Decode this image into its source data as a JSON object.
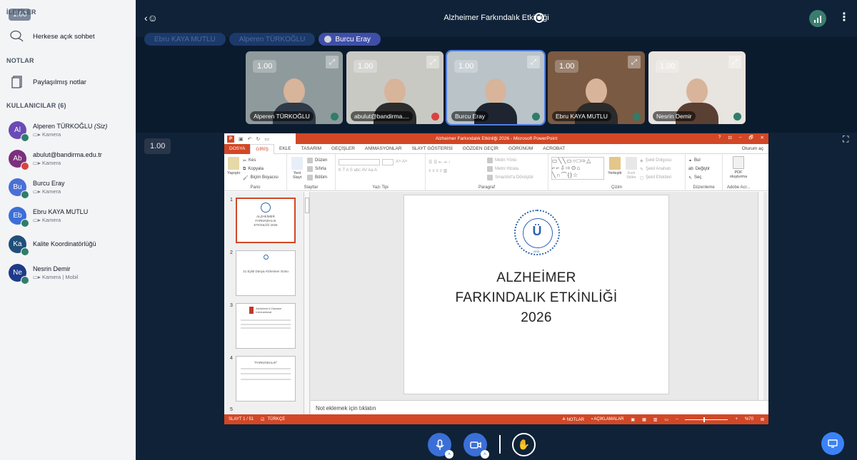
{
  "sidebar": {
    "volume_badge": "1.00",
    "messages_header": "İLETİLER",
    "public_chat": "Herkese açık sohbet",
    "notes_header": "NOTLAR",
    "shared_notes": "Paylaşılmış notlar",
    "users_header": "KULLANICILAR (6)",
    "users": [
      {
        "initials": "Al",
        "name": "Alperen TÜRKOĞLU",
        "suffix": " (Siz)",
        "sub": "Kamera",
        "color": "#6a4bb5",
        "mic": "green"
      },
      {
        "initials": "Ab",
        "name": "abulut@bandirma.edu.tr",
        "suffix": "",
        "sub": "Kamera",
        "color": "#7b2f7c",
        "mic": "red"
      },
      {
        "initials": "Bu",
        "name": "Burcu Eray",
        "suffix": "",
        "sub": "Kamera",
        "color": "#4a6fd6",
        "mic": "green"
      },
      {
        "initials": "Eb",
        "name": "Ebru KAYA MUTLU",
        "suffix": "",
        "sub": "Kamera",
        "color": "#3d6fd6",
        "mic": "green"
      },
      {
        "initials": "Ka",
        "name": "Kalite Koordinatörlüğü",
        "suffix": "",
        "sub": "",
        "color": "#1f4f7a",
        "mic": "green"
      },
      {
        "initials": "Ne",
        "name": "Nesrin Demir",
        "suffix": "",
        "sub": "Kamera | Mobil",
        "color": "#1e3a8a",
        "mic": "green"
      }
    ]
  },
  "topbar": {
    "title": "Alzheimer Farkındalık Etkinliği"
  },
  "chips": [
    "Ebru KAYA MUTLU",
    "Alperen TÜRKOĞLU",
    "Burcu Eray"
  ],
  "tiles": [
    {
      "volume": "1.00",
      "label": "Alperen TÜRKOĞLU",
      "bg": "#8f9a9d",
      "shirt": "#2f3a48",
      "mic": "green",
      "talking": false
    },
    {
      "volume": "1.00",
      "label": "abulut@bandirma....",
      "bg": "#c9c9c4",
      "shirt": "#2c2c2c",
      "mic": "red",
      "talking": false
    },
    {
      "volume": "1.00",
      "label": "Burcu Eray",
      "bg": "#b9c3c8",
      "shirt": "#1f2530",
      "mic": "green",
      "talking": true
    },
    {
      "volume": "1.00",
      "label": "Ebru KAYA MUTLU",
      "bg": "#7a5a42",
      "shirt": "#2b2b2b",
      "mic": "green",
      "talking": false
    },
    {
      "volume": "1.00",
      "label": "Nesrin Demir",
      "bg": "#e8e4df",
      "shirt": "#5a4033",
      "mic": "green",
      "talking": false
    }
  ],
  "main": {
    "volume": "1.00"
  },
  "ppt": {
    "window_title": "Alzheimer Farkındalık Etkinliği 2026 - Microsoft PowerPoint",
    "window_controls": [
      "?",
      "⊡",
      "–",
      "🗗",
      "✕"
    ],
    "tabs": [
      "DOSYA",
      "GİRİŞ",
      "EKLE",
      "TASARIM",
      "GEÇİŞLER",
      "ANİMASYONLAR",
      "SLAYT GÖSTERİSİ",
      "GÖZDEN GEÇİR",
      "GÖRÜNÜM",
      "ACROBAT"
    ],
    "sign_in": "Oturum aç",
    "ribbon": {
      "paste": "Yapıştır",
      "cut": "Kes",
      "copy": "Kopyala",
      "format_painter": "Biçim Boyacısı",
      "pano": "Pano",
      "new_slide": "Yeni Slayt",
      "layout": "Düzen",
      "reset": "Sıfırla",
      "section": "Bölüm",
      "slides": "Slaytlar",
      "font_group": "Yazı Tipi",
      "text_direction": "Metin Yönü",
      "align_text": "Metni Hizala",
      "smartart": "SmartArt'a Dönüştür",
      "paragraph": "Paragraf",
      "arrange": "Yerleştir",
      "quick_styles": "Hızlı Stiller",
      "shape_fill": "Şekil Dolgusu",
      "shape_outline": "Şekil Anahatı",
      "shape_effects": "Şekil Efektleri",
      "drawing": "Çizim",
      "find": "Bul",
      "replace": "Değiştir",
      "select": "Seç",
      "editing": "Düzenleme",
      "pdf": "PDF oluşturma",
      "adobe": "Adobe Acr..."
    },
    "thumb_numbers": [
      "1",
      "2",
      "3",
      "4",
      "5"
    ],
    "thumbs": [
      "ALZHEİMER FARKINDALIK ETKİNLİĞİ 2026",
      "21 Eylül Dünya Alzheimer Günü",
      "Alzheimer's Disease International",
      "\"FARKINDALIK\""
    ],
    "slide_lines": [
      "ALZHEİMER",
      "FARKINDALIK ETKİNLİĞİ",
      "2026"
    ],
    "seal_year": "2015",
    "notes": "Not eklemek için tıklatın",
    "status_slide": "SLAYT 1 / 51",
    "status_lang": "TÜRKÇE",
    "status_notes": "NOTLAR",
    "status_comments": "AÇIKLAMALAR",
    "zoom": "%70"
  }
}
